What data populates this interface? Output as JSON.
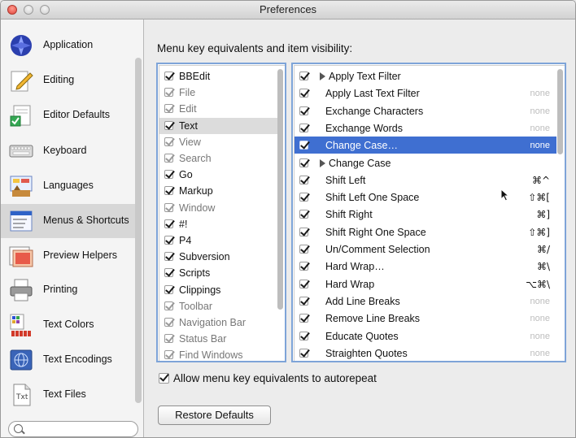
{
  "window": {
    "title": "Preferences"
  },
  "sidebar": {
    "items": [
      {
        "label": "Application",
        "icon": "application-icon",
        "selected": false
      },
      {
        "label": "Editing",
        "icon": "pencil-icon",
        "selected": false
      },
      {
        "label": "Editor Defaults",
        "icon": "document-check-icon",
        "selected": false
      },
      {
        "label": "Keyboard",
        "icon": "keyboard-icon",
        "selected": false
      },
      {
        "label": "Languages",
        "icon": "languages-icon",
        "selected": false
      },
      {
        "label": "Menus & Shortcuts",
        "icon": "menu-icon",
        "selected": true
      },
      {
        "label": "Preview Helpers",
        "icon": "preview-icon",
        "selected": false
      },
      {
        "label": "Printing",
        "icon": "printer-icon",
        "selected": false
      },
      {
        "label": "Text Colors",
        "icon": "color-swatches-icon",
        "selected": false
      },
      {
        "label": "Text Encodings",
        "icon": "globe-icon",
        "selected": false
      },
      {
        "label": "Text Files",
        "icon": "text-file-icon",
        "selected": false
      }
    ],
    "search": {
      "placeholder": ""
    }
  },
  "main": {
    "title": "Menu key equivalents and item visibility:",
    "menus": [
      {
        "label": "BBEdit",
        "checked": true,
        "dim": false,
        "selected": false
      },
      {
        "label": "File",
        "checked": true,
        "dim": true,
        "selected": false
      },
      {
        "label": "Edit",
        "checked": true,
        "dim": true,
        "selected": false
      },
      {
        "label": "Text",
        "checked": true,
        "dim": false,
        "selected": true
      },
      {
        "label": "View",
        "checked": true,
        "dim": true,
        "selected": false
      },
      {
        "label": "Search",
        "checked": true,
        "dim": true,
        "selected": false
      },
      {
        "label": "Go",
        "checked": true,
        "dim": false,
        "selected": false
      },
      {
        "label": "Markup",
        "checked": true,
        "dim": false,
        "selected": false
      },
      {
        "label": "Window",
        "checked": true,
        "dim": true,
        "selected": false
      },
      {
        "label": "#!",
        "checked": true,
        "dim": false,
        "selected": false
      },
      {
        "label": "P4",
        "checked": true,
        "dim": false,
        "selected": false
      },
      {
        "label": "Subversion",
        "checked": true,
        "dim": false,
        "selected": false
      },
      {
        "label": "Scripts",
        "checked": true,
        "dim": false,
        "selected": false
      },
      {
        "label": "Clippings",
        "checked": true,
        "dim": false,
        "selected": false
      },
      {
        "label": "Toolbar",
        "checked": true,
        "dim": true,
        "selected": false
      },
      {
        "label": "Navigation Bar",
        "checked": true,
        "dim": true,
        "selected": false
      },
      {
        "label": "Status Bar",
        "checked": true,
        "dim": true,
        "selected": false
      },
      {
        "label": "Find Windows",
        "checked": true,
        "dim": true,
        "selected": false
      }
    ],
    "commands": [
      {
        "label": "Apply Text Filter",
        "shortcut": "",
        "group": true,
        "selected": false
      },
      {
        "label": "Apply Last Text Filter",
        "shortcut": "none",
        "group": false,
        "selected": false
      },
      {
        "label": "Exchange Characters",
        "shortcut": "none",
        "group": false,
        "selected": false
      },
      {
        "label": "Exchange Words",
        "shortcut": "none",
        "group": false,
        "selected": false
      },
      {
        "label": "Change Case…",
        "shortcut": "none",
        "group": false,
        "selected": true
      },
      {
        "label": "Change Case",
        "shortcut": "",
        "group": true,
        "selected": false
      },
      {
        "label": "Shift Left",
        "shortcut": "⌘^",
        "group": false,
        "selected": false
      },
      {
        "label": "Shift Left One Space",
        "shortcut": "⇧⌘[",
        "group": false,
        "selected": false
      },
      {
        "label": "Shift Right",
        "shortcut": "⌘]",
        "group": false,
        "selected": false
      },
      {
        "label": "Shift Right One Space",
        "shortcut": "⇧⌘]",
        "group": false,
        "selected": false
      },
      {
        "label": "Un/Comment Selection",
        "shortcut": "⌘/",
        "group": false,
        "selected": false
      },
      {
        "label": "Hard Wrap…",
        "shortcut": "⌘\\",
        "group": false,
        "selected": false
      },
      {
        "label": "Hard Wrap",
        "shortcut": "⌥⌘\\",
        "group": false,
        "selected": false
      },
      {
        "label": "Add Line Breaks",
        "shortcut": "none",
        "group": false,
        "selected": false
      },
      {
        "label": "Remove Line Breaks",
        "shortcut": "none",
        "group": false,
        "selected": false
      },
      {
        "label": "Educate Quotes",
        "shortcut": "none",
        "group": false,
        "selected": false
      },
      {
        "label": "Straighten Quotes",
        "shortcut": "none",
        "group": false,
        "selected": false
      }
    ],
    "autorepeat": {
      "label": "Allow menu key equivalents to autorepeat",
      "checked": true
    },
    "restore_label": "Restore Defaults"
  },
  "colors": {
    "selection": "#3f6fd1",
    "focus_ring": "#7ea4d8",
    "sidebar_selected": "#d7d7d7"
  }
}
